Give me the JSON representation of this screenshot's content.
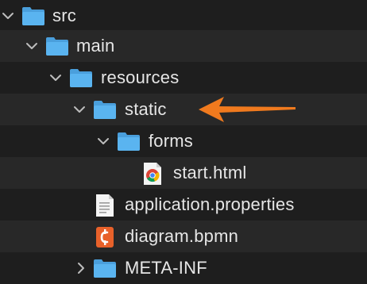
{
  "tree": {
    "items": [
      {
        "label": "src",
        "type": "folder",
        "expanded": true,
        "depth": 0
      },
      {
        "label": "main",
        "type": "folder",
        "expanded": true,
        "depth": 1
      },
      {
        "label": "resources",
        "type": "folder",
        "expanded": true,
        "depth": 2
      },
      {
        "label": "static",
        "type": "folder",
        "expanded": true,
        "depth": 3
      },
      {
        "label": "forms",
        "type": "folder",
        "expanded": true,
        "depth": 4
      },
      {
        "label": "start.html",
        "type": "html-file",
        "depth": 5
      },
      {
        "label": "application.properties",
        "type": "text-file",
        "depth": 3
      },
      {
        "label": "diagram.bpmn",
        "type": "bpmn-file",
        "depth": 3
      },
      {
        "label": "META-INF",
        "type": "folder",
        "expanded": false,
        "depth": 3
      }
    ]
  },
  "colors": {
    "background": "#1e1e1e",
    "row_alt": "#282828",
    "folder": "#5ab4f0",
    "text": "#e6e6e6",
    "arrow": "#f07a1e",
    "bpmn_badge": "#e8612a"
  },
  "annotation": {
    "icon": "orange-arrow-icon",
    "points_to": "static"
  }
}
